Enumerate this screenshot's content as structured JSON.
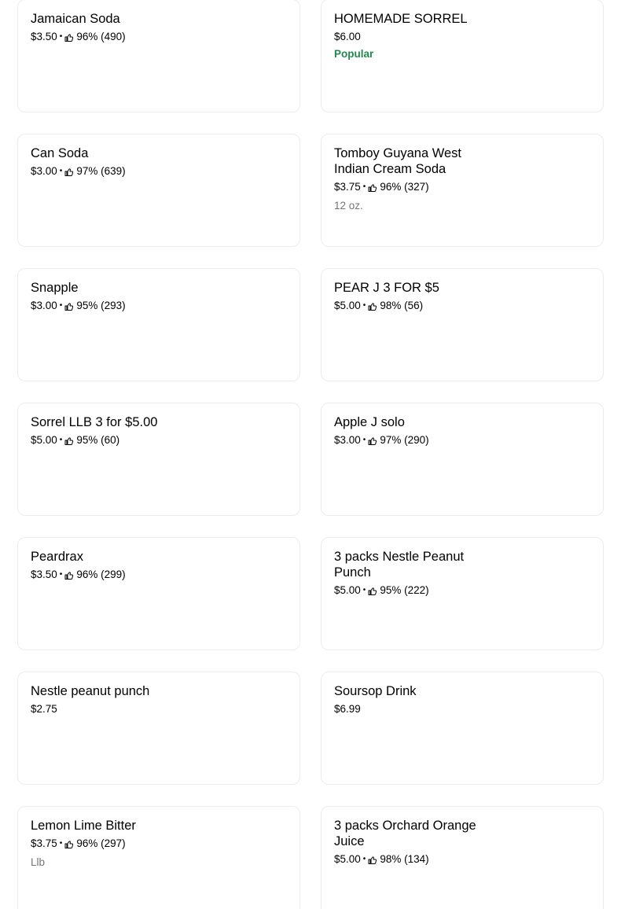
{
  "items": [
    {
      "name": "Jamaican Soda",
      "price": "$3.50",
      "rating": "96% (490)",
      "note": "",
      "badge": ""
    },
    {
      "name": "HOMEMADE SORREL",
      "price": "$6.00",
      "rating": "",
      "note": "",
      "badge": "Popular"
    },
    {
      "name": "Can Soda",
      "price": "$3.00",
      "rating": "97% (639)",
      "note": "",
      "badge": ""
    },
    {
      "name": "Tomboy Guyana West Indian Cream Soda",
      "price": "$3.75",
      "rating": "96% (327)",
      "note": "12 oz.",
      "badge": ""
    },
    {
      "name": "Snapple",
      "price": "$3.00",
      "rating": "95% (293)",
      "note": "",
      "badge": ""
    },
    {
      "name": "PEAR J 3 FOR $5",
      "price": "$5.00",
      "rating": "98% (56)",
      "note": "",
      "badge": ""
    },
    {
      "name": "Sorrel LLB 3 for $5.00",
      "price": "$5.00",
      "rating": "95% (60)",
      "note": "",
      "badge": ""
    },
    {
      "name": "Apple J solo",
      "price": "$3.00",
      "rating": "97% (290)",
      "note": "",
      "badge": ""
    },
    {
      "name": "Peardrax",
      "price": "$3.50",
      "rating": "96% (299)",
      "note": "",
      "badge": ""
    },
    {
      "name": "3 packs Nestle Peanut Punch",
      "price": "$5.00",
      "rating": "95% (222)",
      "note": "",
      "badge": ""
    },
    {
      "name": "Nestle peanut punch",
      "price": "$2.75",
      "rating": "",
      "note": "",
      "badge": ""
    },
    {
      "name": "Soursop Drink",
      "price": "$6.99",
      "rating": "",
      "note": "",
      "badge": ""
    },
    {
      "name": "Lemon Lime Bitter",
      "price": "$3.75",
      "rating": "96% (297)",
      "note": "Llb",
      "badge": ""
    },
    {
      "name": "3 packs Orchard Orange Juice",
      "price": "$5.00",
      "rating": "98% (134)",
      "note": "",
      "badge": ""
    }
  ],
  "icons": {
    "rating": "thumbs-up-icon"
  },
  "colors": {
    "popular": "#1f8a4c",
    "border": "#ececec",
    "note": "#757575"
  }
}
